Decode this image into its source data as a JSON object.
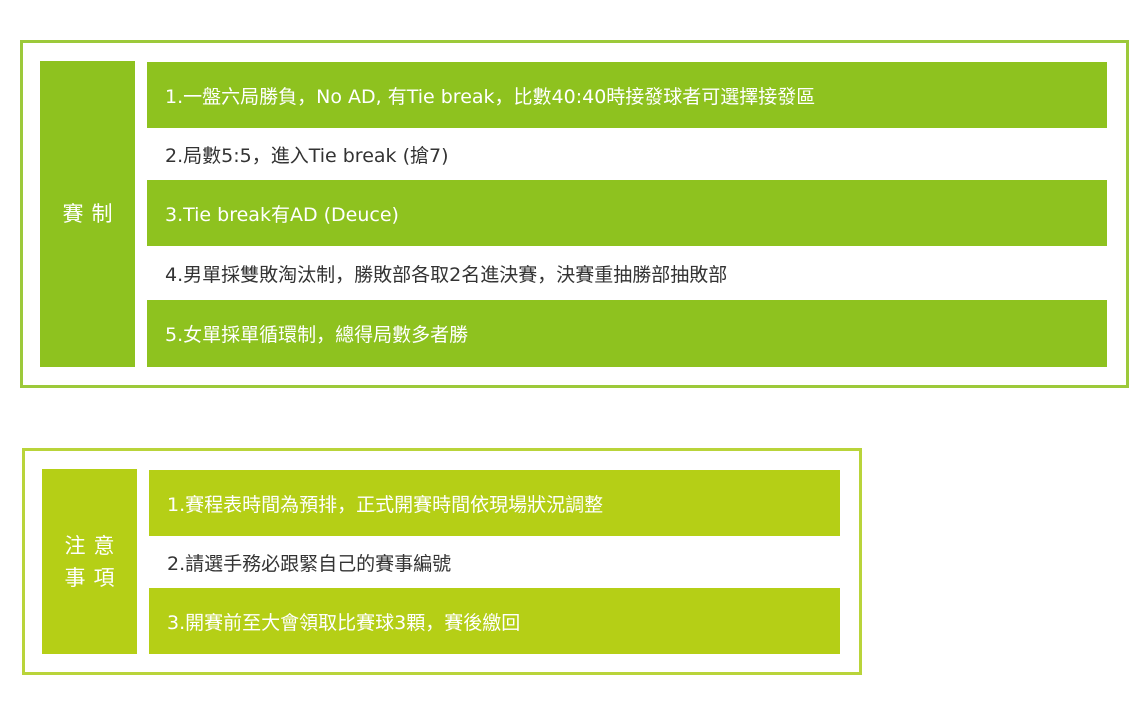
{
  "colors": {
    "rules_green": "#8ec21f",
    "notes_green": "#b5cf16",
    "rules_border": "#9cc93a",
    "notes_border": "#b9d43a",
    "plain_text": "#333333",
    "filled_text": "#ffffff"
  },
  "rules": {
    "label": "賽制",
    "items": [
      {
        "text": "1.一盤六局勝負，No AD, 有Tie break，比數40:40時接發球者可選擇接發區",
        "style": "filled"
      },
      {
        "text": "2.局數5:5，進入Tie break (搶7)",
        "style": "plain"
      },
      {
        "text": "3.Tie break有AD (Deuce)",
        "style": "filled"
      },
      {
        "text": "4.男單採雙敗淘汰制，勝敗部各取2名進決賽，決賽重抽勝部抽敗部",
        "style": "plain"
      },
      {
        "text": "5.女單採單循環制，總得局數多者勝",
        "style": "filled"
      }
    ]
  },
  "notes": {
    "label_lines": [
      "注意",
      "事項"
    ],
    "items": [
      {
        "text": "1.賽程表時間為預排，正式開賽時間依現場狀況調整",
        "style": "filled"
      },
      {
        "text": "2.請選手務必跟緊自己的賽事編號",
        "style": "plain"
      },
      {
        "text": "3.開賽前至大會領取比賽球3顆，賽後繳回",
        "style": "filled"
      }
    ]
  }
}
